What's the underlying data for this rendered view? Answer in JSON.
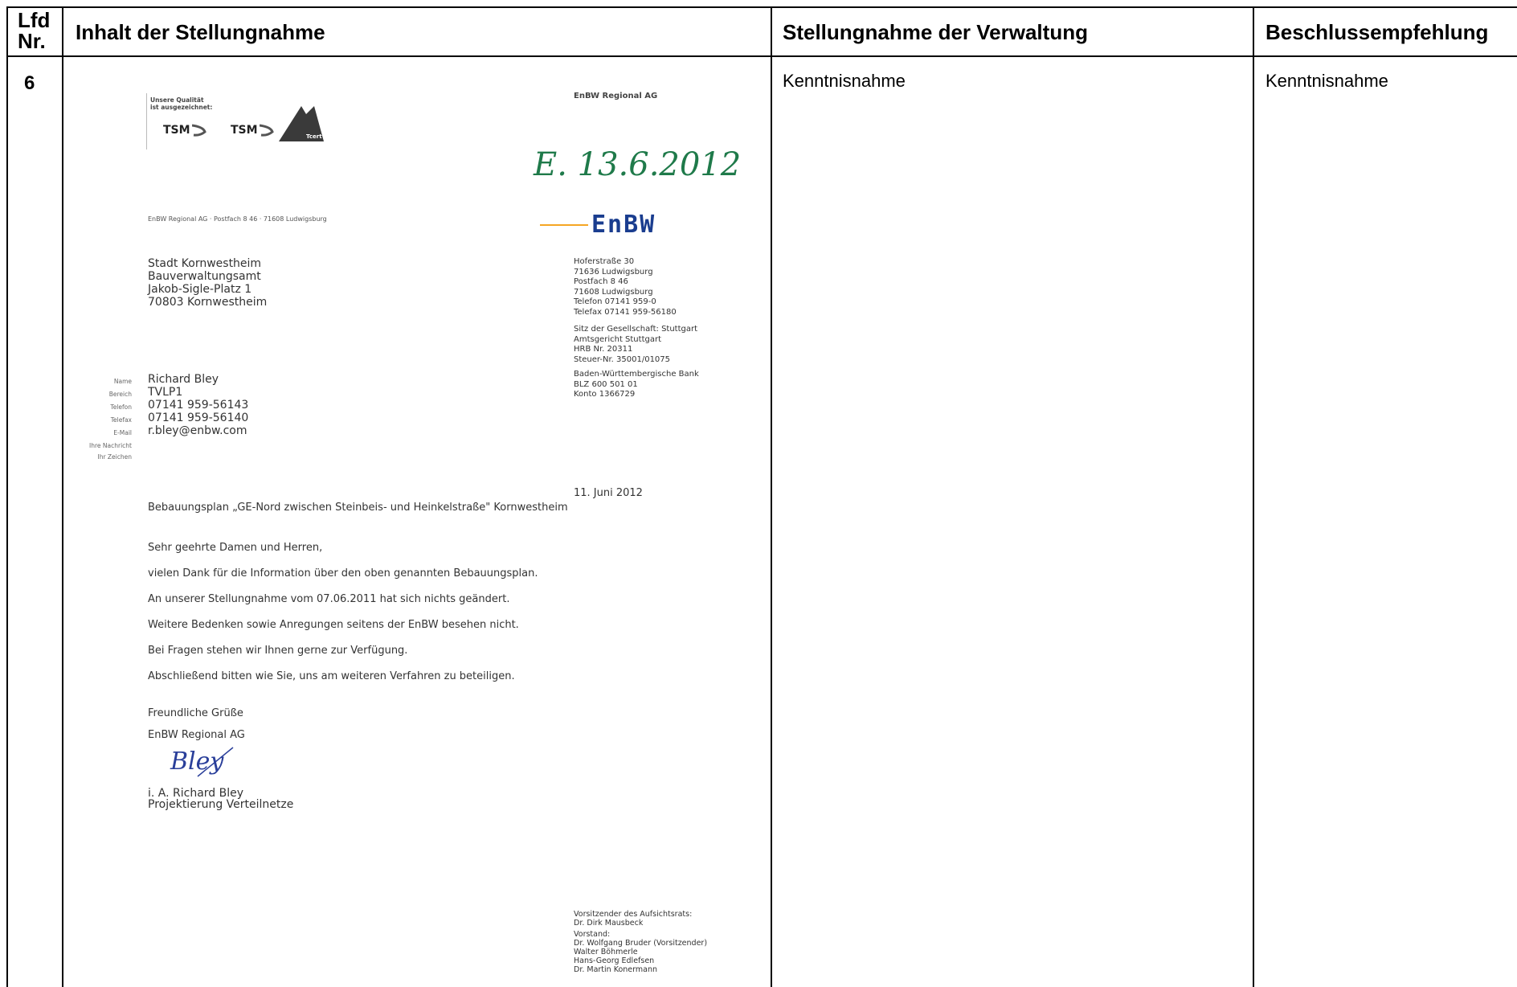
{
  "table": {
    "headers": {
      "nr": "Lfd Nr.",
      "inhalt": "Inhalt der Stellungnahme",
      "verwaltung": "Stellungnahme der Verwaltung",
      "beschluss": "Beschlussempfehlung"
    },
    "row": {
      "nr": "6",
      "verwaltung": "Kenntnisnahme",
      "beschluss": "Kenntnisnahme"
    }
  },
  "letter": {
    "quality_line1": "Unsere Qualität",
    "quality_line2": "ist ausgezeichnet:",
    "cert1": "TSM",
    "cert2": "TSM",
    "cert3": "Tcert",
    "company_head": "EnBW Regional AG",
    "received_stamp": "E. 13.6.2012",
    "logo_text": "EnBW",
    "return_address": "EnBW Regional AG · Postfach 8 46 · 71608 Ludwigsburg",
    "recipient": [
      "Stadt Kornwestheim",
      "Bauverwaltungsamt",
      "Jakob-Sigle-Platz 1",
      "70803 Kornwestheim"
    ],
    "sender_info": [
      "Hoferstraße 30",
      "71636 Ludwigsburg",
      "Postfach 8 46",
      "71608 Ludwigsburg",
      "Telefon  07141 959-0",
      "Telefax  07141 959-56180"
    ],
    "company_info": [
      "Sitz der Gesellschaft: Stuttgart",
      "Amtsgericht Stuttgart",
      "HRB Nr. 20311",
      "Steuer-Nr. 35001/01075"
    ],
    "bank_info": [
      "Baden-Württembergische Bank",
      "BLZ 600 501 01",
      "Konto 1366729"
    ],
    "contact_labels": [
      "Name",
      "Bereich",
      "Telefon",
      "Telefax",
      "E-Mail",
      "Ihre Nachricht",
      "Ihr Zeichen"
    ],
    "contact_values": [
      "Richard Bley",
      "TVLP1",
      "07141 959-56143",
      "07141 959-56140",
      "r.bley@enbw.com"
    ],
    "date": "11. Juni 2012",
    "subject": "Bebauungsplan „GE-Nord zwischen Steinbeis- und Heinkelstraße\" Kornwestheim",
    "salutation": "Sehr geehrte Damen und Herren,",
    "paragraphs": [
      "vielen Dank für die Information über den oben genannten Bebauungsplan.",
      "An unserer Stellungnahme vom 07.06.2011 hat sich nichts geändert.",
      "Weitere Bedenken sowie Anregungen seitens der EnBW besehen nicht.",
      "Bei Fragen stehen wir Ihnen gerne zur Verfügung.",
      "Abschließend bitten wie Sie, uns am weiteren Verfahren zu beteiligen."
    ],
    "closing": "Freundliche Grüße",
    "closing_company": "EnBW Regional  AG",
    "signature": "Bley",
    "signer": "i. A. Richard Bley",
    "signer_title": "Projektierung Verteilnetze",
    "board_info": [
      "Vorsitzender des Aufsichtsrats:",
      "Dr. Dirk Mausbeck",
      "Vorstand:",
      "Dr. Wolfgang Bruder (Vorsitzender)",
      "Walter Böhmerle",
      "Hans-Georg Edlefsen",
      "Dr. Martin Konermann"
    ]
  },
  "colors": {
    "logo_blue": "#1a3d8f",
    "logo_orange": "#f5a623",
    "stamp_green": "#1f7a4a"
  }
}
